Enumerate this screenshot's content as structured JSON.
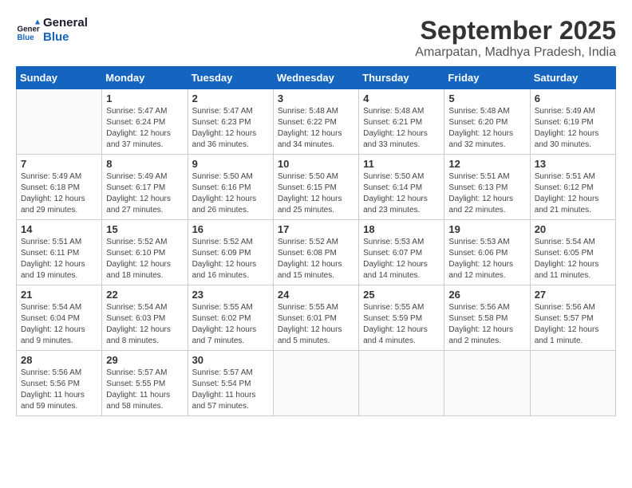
{
  "header": {
    "logo_line1": "General",
    "logo_line2": "Blue",
    "month": "September 2025",
    "location": "Amarpatan, Madhya Pradesh, India"
  },
  "weekdays": [
    "Sunday",
    "Monday",
    "Tuesday",
    "Wednesday",
    "Thursday",
    "Friday",
    "Saturday"
  ],
  "weeks": [
    [
      {
        "day": "",
        "info": ""
      },
      {
        "day": "1",
        "info": "Sunrise: 5:47 AM\nSunset: 6:24 PM\nDaylight: 12 hours\nand 37 minutes."
      },
      {
        "day": "2",
        "info": "Sunrise: 5:47 AM\nSunset: 6:23 PM\nDaylight: 12 hours\nand 36 minutes."
      },
      {
        "day": "3",
        "info": "Sunrise: 5:48 AM\nSunset: 6:22 PM\nDaylight: 12 hours\nand 34 minutes."
      },
      {
        "day": "4",
        "info": "Sunrise: 5:48 AM\nSunset: 6:21 PM\nDaylight: 12 hours\nand 33 minutes."
      },
      {
        "day": "5",
        "info": "Sunrise: 5:48 AM\nSunset: 6:20 PM\nDaylight: 12 hours\nand 32 minutes."
      },
      {
        "day": "6",
        "info": "Sunrise: 5:49 AM\nSunset: 6:19 PM\nDaylight: 12 hours\nand 30 minutes."
      }
    ],
    [
      {
        "day": "7",
        "info": "Sunrise: 5:49 AM\nSunset: 6:18 PM\nDaylight: 12 hours\nand 29 minutes."
      },
      {
        "day": "8",
        "info": "Sunrise: 5:49 AM\nSunset: 6:17 PM\nDaylight: 12 hours\nand 27 minutes."
      },
      {
        "day": "9",
        "info": "Sunrise: 5:50 AM\nSunset: 6:16 PM\nDaylight: 12 hours\nand 26 minutes."
      },
      {
        "day": "10",
        "info": "Sunrise: 5:50 AM\nSunset: 6:15 PM\nDaylight: 12 hours\nand 25 minutes."
      },
      {
        "day": "11",
        "info": "Sunrise: 5:50 AM\nSunset: 6:14 PM\nDaylight: 12 hours\nand 23 minutes."
      },
      {
        "day": "12",
        "info": "Sunrise: 5:51 AM\nSunset: 6:13 PM\nDaylight: 12 hours\nand 22 minutes."
      },
      {
        "day": "13",
        "info": "Sunrise: 5:51 AM\nSunset: 6:12 PM\nDaylight: 12 hours\nand 21 minutes."
      }
    ],
    [
      {
        "day": "14",
        "info": "Sunrise: 5:51 AM\nSunset: 6:11 PM\nDaylight: 12 hours\nand 19 minutes."
      },
      {
        "day": "15",
        "info": "Sunrise: 5:52 AM\nSunset: 6:10 PM\nDaylight: 12 hours\nand 18 minutes."
      },
      {
        "day": "16",
        "info": "Sunrise: 5:52 AM\nSunset: 6:09 PM\nDaylight: 12 hours\nand 16 minutes."
      },
      {
        "day": "17",
        "info": "Sunrise: 5:52 AM\nSunset: 6:08 PM\nDaylight: 12 hours\nand 15 minutes."
      },
      {
        "day": "18",
        "info": "Sunrise: 5:53 AM\nSunset: 6:07 PM\nDaylight: 12 hours\nand 14 minutes."
      },
      {
        "day": "19",
        "info": "Sunrise: 5:53 AM\nSunset: 6:06 PM\nDaylight: 12 hours\nand 12 minutes."
      },
      {
        "day": "20",
        "info": "Sunrise: 5:54 AM\nSunset: 6:05 PM\nDaylight: 12 hours\nand 11 minutes."
      }
    ],
    [
      {
        "day": "21",
        "info": "Sunrise: 5:54 AM\nSunset: 6:04 PM\nDaylight: 12 hours\nand 9 minutes."
      },
      {
        "day": "22",
        "info": "Sunrise: 5:54 AM\nSunset: 6:03 PM\nDaylight: 12 hours\nand 8 minutes."
      },
      {
        "day": "23",
        "info": "Sunrise: 5:55 AM\nSunset: 6:02 PM\nDaylight: 12 hours\nand 7 minutes."
      },
      {
        "day": "24",
        "info": "Sunrise: 5:55 AM\nSunset: 6:01 PM\nDaylight: 12 hours\nand 5 minutes."
      },
      {
        "day": "25",
        "info": "Sunrise: 5:55 AM\nSunset: 5:59 PM\nDaylight: 12 hours\nand 4 minutes."
      },
      {
        "day": "26",
        "info": "Sunrise: 5:56 AM\nSunset: 5:58 PM\nDaylight: 12 hours\nand 2 minutes."
      },
      {
        "day": "27",
        "info": "Sunrise: 5:56 AM\nSunset: 5:57 PM\nDaylight: 12 hours\nand 1 minute."
      }
    ],
    [
      {
        "day": "28",
        "info": "Sunrise: 5:56 AM\nSunset: 5:56 PM\nDaylight: 11 hours\nand 59 minutes."
      },
      {
        "day": "29",
        "info": "Sunrise: 5:57 AM\nSunset: 5:55 PM\nDaylight: 11 hours\nand 58 minutes."
      },
      {
        "day": "30",
        "info": "Sunrise: 5:57 AM\nSunset: 5:54 PM\nDaylight: 11 hours\nand 57 minutes."
      },
      {
        "day": "",
        "info": ""
      },
      {
        "day": "",
        "info": ""
      },
      {
        "day": "",
        "info": ""
      },
      {
        "day": "",
        "info": ""
      }
    ]
  ]
}
